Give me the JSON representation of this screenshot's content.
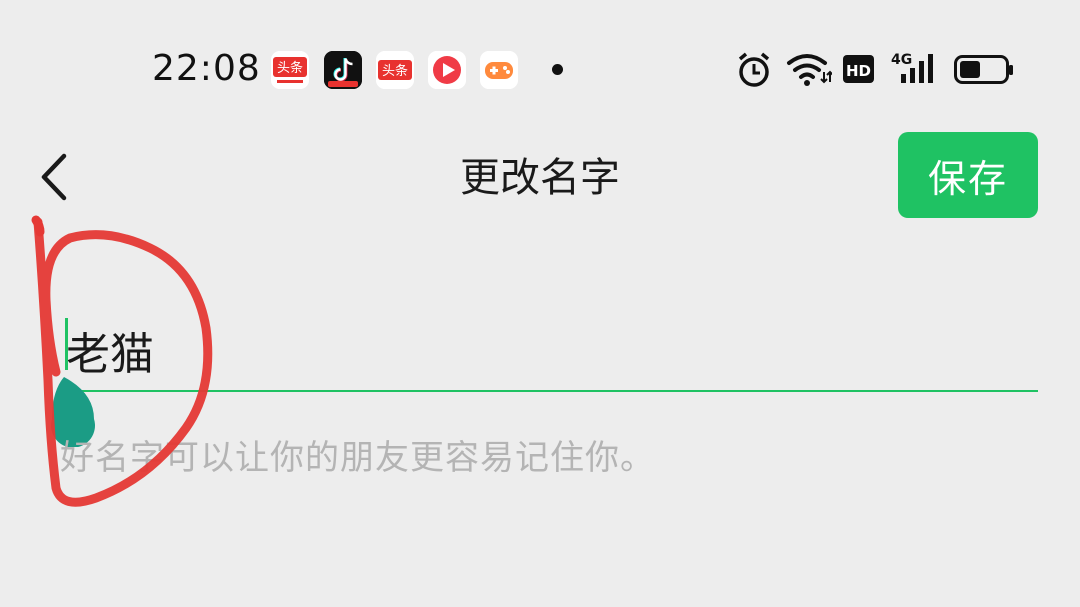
{
  "status_bar": {
    "time": "22:08",
    "notification_apps": [
      {
        "name": "toutiao-lite-icon",
        "label": "头条",
        "color": "#e8322f"
      },
      {
        "name": "douyin-lite-icon",
        "label": "",
        "color": "#111111"
      },
      {
        "name": "toutiao-icon",
        "label": "头条",
        "color": "#e8322f"
      },
      {
        "name": "video-app-icon",
        "label": "",
        "color": "#f03b46"
      },
      {
        "name": "game-center-icon",
        "label": "",
        "color": "#ff8a3d"
      }
    ],
    "system_icons": [
      "alarm-icon",
      "wifi-icon",
      "hd-icon",
      "signal-4g-icon",
      "battery-icon"
    ],
    "hd_label": "HD",
    "network_label": "4G"
  },
  "nav": {
    "title": "更改名字",
    "save_label": "保存"
  },
  "form": {
    "name_value": "老猫",
    "hint": "好名字可以让你的朋友更容易记住你。"
  },
  "colors": {
    "accent": "#1fc263",
    "background": "#ededed",
    "hint": "#b4b4b4",
    "annotation": "#e53935",
    "handle": "#1b9c85"
  }
}
